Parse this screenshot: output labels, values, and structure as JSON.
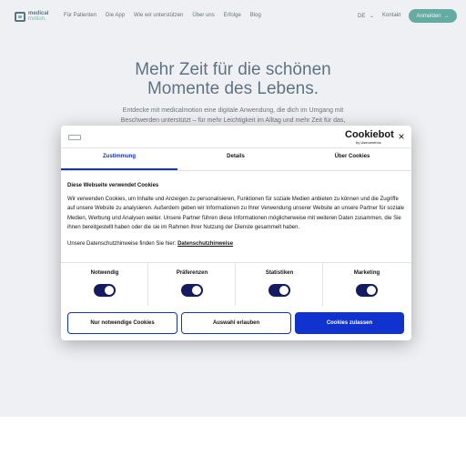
{
  "nav": {
    "logo_line1": "medical",
    "logo_line2": "motion.",
    "links": [
      "Für Patienten",
      "Die App",
      "Wie wir unterstützen",
      "Über uns",
      "Erfolge",
      "Blog"
    ],
    "language": "DE",
    "contact": "Kontakt",
    "cta": "Anmelden",
    "cta_arrow": "→",
    "lang_chevron": "⌄"
  },
  "hero": {
    "title_line1": "Mehr Zeit für die schönen",
    "title_line2": "Momente des Lebens.",
    "subtitle_line1": "Entdecke mit medicalmotion eine digitale Anwendung, die dich im Umgang mit",
    "subtitle_line2": "Beschwerden unterstützt – für mehr Leichtigkeit im Alltag und mehr Zeit für das,"
  },
  "cookie": {
    "brand": "Cookiebot",
    "brand_sub": "by Usercentrics",
    "close": "×",
    "tabs": [
      "Zustimmung",
      "Details",
      "Über Cookies"
    ],
    "heading": "Diese Webseite verwendet Cookies",
    "body": "Wir verwenden Cookies, um Inhalte und Anzeigen zu personalisieren, Funktionen für soziale Medien anbieten zu können und die Zugriffe auf unsere Website zu analysieren. Außerdem geben wir Informationen zu Ihrer Verwendung unserer Website an unsere Partner für soziale Medien, Werbung und Analysen weiter. Unsere Partner führen diese Informationen möglicherweise mit weiteren Daten zusammen, die Sie ihnen bereitgestellt haben oder die sie im Rahmen Ihrer Nutzung der Dienste gesammelt haben.",
    "link_prefix": "Unsere Datenschutzhinweise finden Sie hier:",
    "link_text": "Datenschutzhinweise",
    "toggles": [
      "Notwendig",
      "Präferenzen",
      "Statistiken",
      "Marketing"
    ],
    "buttons": {
      "necessary": "Nur notwendige Cookies",
      "selection": "Auswahl erlauben",
      "all": "Cookies zulassen"
    }
  },
  "colors": {
    "accent": "#1032cf",
    "brand_green": "#1f8a7a",
    "navy": "#13334c"
  }
}
